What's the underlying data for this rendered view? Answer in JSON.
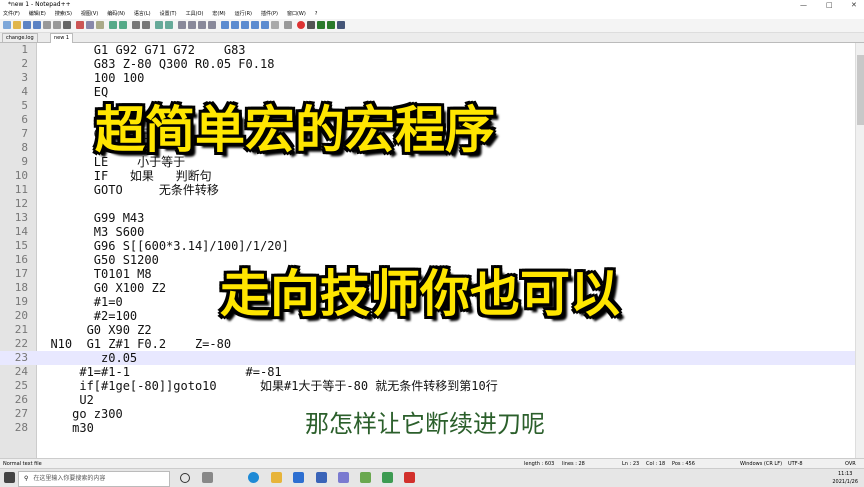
{
  "window": {
    "title": "*new 1 - Notepad++"
  },
  "menu": [
    "文件(F)",
    "编辑(E)",
    "搜索(S)",
    "视图(V)",
    "编码(N)",
    "语言(L)",
    "设置(T)",
    "工具(O)",
    "宏(M)",
    "运行(R)",
    "插件(P)",
    "窗口(W)",
    "?"
  ],
  "tabs": [
    {
      "label": "change.log",
      "active": false
    },
    {
      "label": "new 1",
      "active": true
    }
  ],
  "lines": [
    {
      "n": "1",
      "text": "        G1 G92 G71 G72    G83"
    },
    {
      "n": "2",
      "text": "        G83 Z-80 Q300 R0.05 F0.18"
    },
    {
      "n": "3",
      "text": "        100 100"
    },
    {
      "n": "4",
      "text": "        EQ"
    },
    {
      "n": "5",
      "text": ""
    },
    {
      "n": "6",
      "text": ""
    },
    {
      "n": "7",
      "text": "        GE   大于等于"
    },
    {
      "n": "8",
      "text": "        LT   小于"
    },
    {
      "n": "9",
      "text": "        LE    小于等于"
    },
    {
      "n": "10",
      "text": "        IF   如果   判断句"
    },
    {
      "n": "11",
      "text": "        GOTO     无条件转移"
    },
    {
      "n": "12",
      "text": ""
    },
    {
      "n": "13",
      "text": "        G99 M43"
    },
    {
      "n": "14",
      "text": "        M3 S600"
    },
    {
      "n": "15",
      "text": "        G96 S[[600*3.14]/100]/1/20]"
    },
    {
      "n": "16",
      "text": "        G50 S1200"
    },
    {
      "n": "17",
      "text": "        T0101 M8"
    },
    {
      "n": "18",
      "text": "        G0 X100 Z2"
    },
    {
      "n": "19",
      "text": "        #1=0"
    },
    {
      "n": "20",
      "text": "        #2=100"
    },
    {
      "n": "21",
      "text": "       G0 X90 Z2"
    },
    {
      "n": "22",
      "text": "  N10  G1 Z#1 F0.2    Z=-80"
    },
    {
      "n": "23",
      "text": "         z0.05"
    },
    {
      "n": "24",
      "text": "      #1=#1-1                #=-81"
    },
    {
      "n": "25",
      "text": "      if[#1ge[-80]]goto10      如果#1大于等于-80 就无条件转移到第10行"
    },
    {
      "n": "26",
      "text": "      U2"
    },
    {
      "n": "27",
      "text": "     go z300"
    },
    {
      "n": "28",
      "text": "     m30"
    }
  ],
  "current_line": "23",
  "overlay": {
    "title1": "超简单宏的宏程序",
    "title2": "走向技师你也可以",
    "subtitle": "那怎样让它断续进刀呢"
  },
  "status": {
    "file_type": "Normal text file",
    "length": "length : 603",
    "lines": "lines : 28",
    "ln": "Ln : 23",
    "col": "Col : 18",
    "pos": "Pos : 456",
    "eol": "Windows (CR LF)",
    "encoding": "UTF-8",
    "mode": "OVR"
  },
  "taskbar": {
    "search_placeholder": "在这里输入你要搜索的内容",
    "time": "11:13",
    "date": "2021/1/26"
  }
}
